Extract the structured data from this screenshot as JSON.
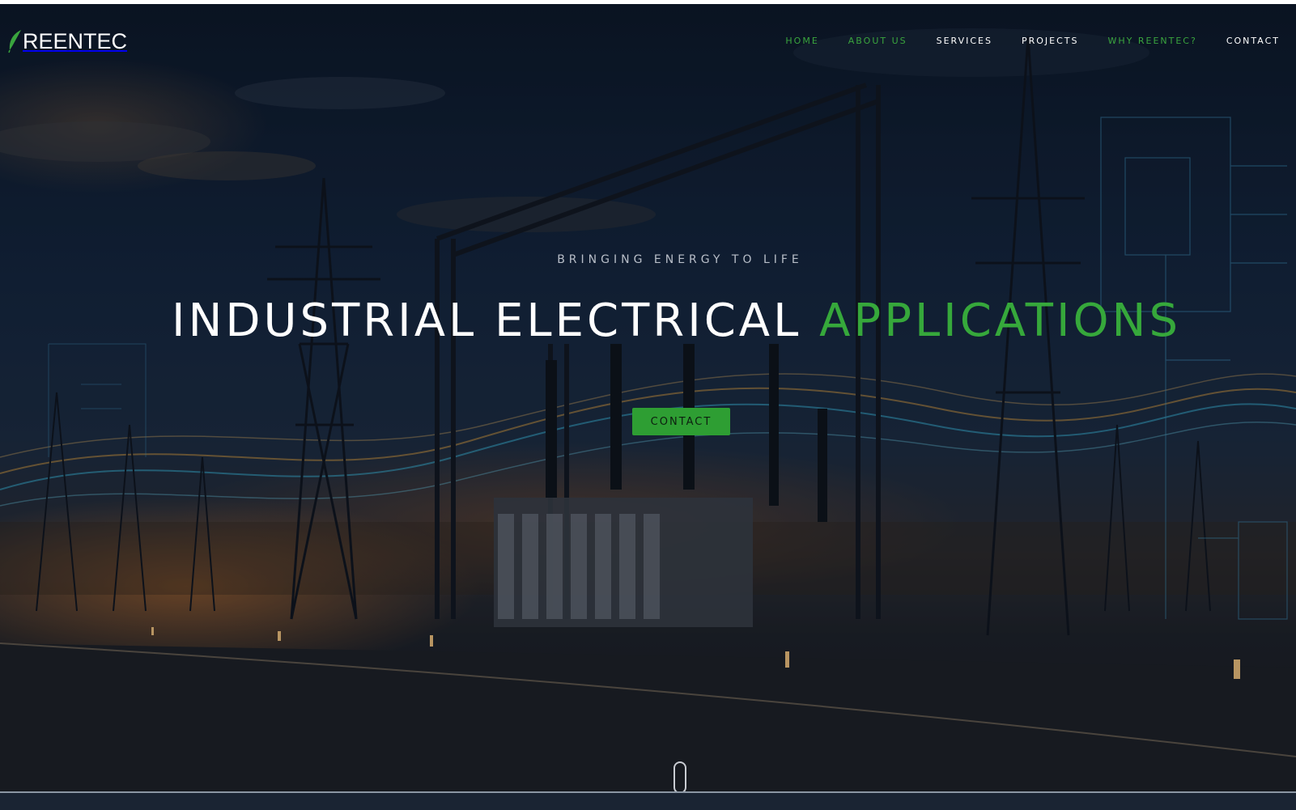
{
  "brand": {
    "name": "REENTEC",
    "leaf_color": "#3aa53e"
  },
  "nav": {
    "items": [
      {
        "label": "HOME",
        "accent": true
      },
      {
        "label": "ABOUT US",
        "accent": true
      },
      {
        "label": "SERVICES",
        "accent": false
      },
      {
        "label": "PROJECTS",
        "accent": false
      },
      {
        "label": "WHY REENTEC?",
        "accent": true
      },
      {
        "label": "CONTACT",
        "accent": false
      }
    ]
  },
  "hero": {
    "tagline": "BRINGING ENERGY TO LIFE",
    "headline_white": "INDUSTRIAL ELECTRICAL",
    "headline_green": "APPLICATIONS",
    "cta_label": "CONTACT",
    "accent_color": "#36a83b"
  },
  "icons": {
    "logo": "leaf-icon",
    "scroll": "mouse-scroll-icon"
  }
}
